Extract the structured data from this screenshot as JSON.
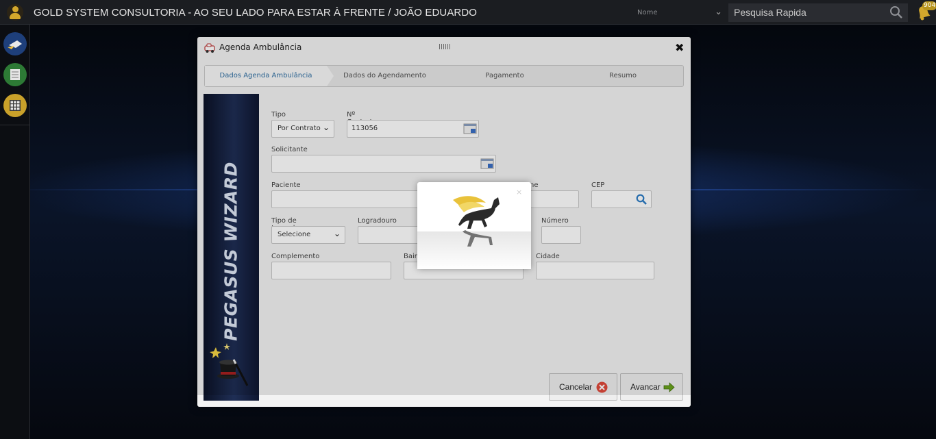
{
  "topbar": {
    "title": "GOLD SYSTEM CONSULTORIA - AO SEU LADO PARA ESTAR À FRENTE / JOÃO EDUARDO",
    "search_field_select": "Nome",
    "search_placeholder": "Pesquisa Rapida",
    "notification_count": "904"
  },
  "dialog": {
    "title": "Agenda Ambulância",
    "steps": [
      {
        "label": "Dados Agenda Ambulância"
      },
      {
        "label": "Dados do Agendamento"
      },
      {
        "label": "Pagamento"
      },
      {
        "label": "Resumo"
      }
    ],
    "side_banner": "PEGASUS WIZARD",
    "form": {
      "tipo": {
        "label": "Tipo",
        "value": "Por Contrato"
      },
      "contrato": {
        "label": "Nº Contrato",
        "value": "113056"
      },
      "solicitante": {
        "label": "Solicitante",
        "value": ""
      },
      "paciente": {
        "label": "Paciente",
        "value": ""
      },
      "telefone": {
        "label": "ne",
        "value": ""
      },
      "cep": {
        "label": "CEP",
        "value": ""
      },
      "tipo_logradouro": {
        "label": "Tipo de Logradouro",
        "value": "Selecione"
      },
      "logradouro": {
        "label": "Logradouro",
        "value": ""
      },
      "numero": {
        "label": "Número",
        "value": ""
      },
      "complemento": {
        "label": "Complemento",
        "value": ""
      },
      "bairro": {
        "label": "Bairr",
        "value": ""
      },
      "cidade": {
        "label": "Cidade",
        "value": ""
      }
    },
    "buttons": {
      "cancel": "Cancelar",
      "next": "Avancar"
    }
  },
  "loader": {
    "close_glyph": "×"
  },
  "colors": {
    "accent_gold": "#d3a72c",
    "step_active_text": "#2f6fa3",
    "cancel_icon": "#e0493b",
    "next_icon": "#6aa31c"
  }
}
